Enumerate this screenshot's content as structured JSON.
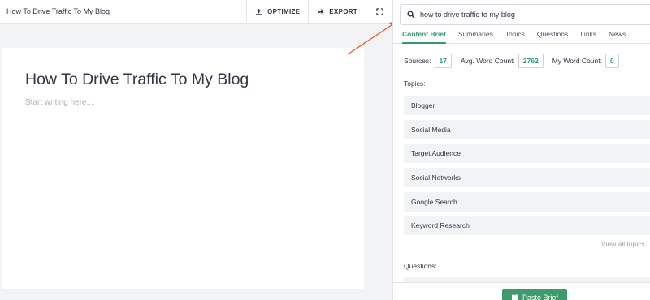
{
  "header": {
    "doc_title": "How To Drive Traffic To My Blog",
    "optimize_label": "OPTIMIZE",
    "export_label": "EXPORT"
  },
  "editor": {
    "heading": "How To Drive Traffic To My Blog",
    "placeholder": "Start writing here..."
  },
  "search": {
    "value": "how to drive traffic to my blog"
  },
  "tabs": [
    {
      "label": "Content Brief",
      "active": true
    },
    {
      "label": "Summaries",
      "active": false
    },
    {
      "label": "Topics",
      "active": false
    },
    {
      "label": "Questions",
      "active": false
    },
    {
      "label": "Links",
      "active": false
    },
    {
      "label": "News",
      "active": false
    }
  ],
  "stats": {
    "sources_label": "Sources:",
    "sources_value": "17",
    "avg_label": "Avg. Word Count:",
    "avg_value": "2762",
    "my_label": "My Word Count:",
    "my_value": "0"
  },
  "topics_label": "Topics:",
  "topics": [
    "Blogger",
    "Social Media",
    "Target Audience",
    "Social Networks",
    "Google Search",
    "Keyword Research"
  ],
  "view_all": "View all topics",
  "questions_label": "Questions:",
  "paste_brief": "Paste Brief",
  "colors": {
    "accent": "#2f9e6e",
    "arrow": "#e8572a"
  }
}
